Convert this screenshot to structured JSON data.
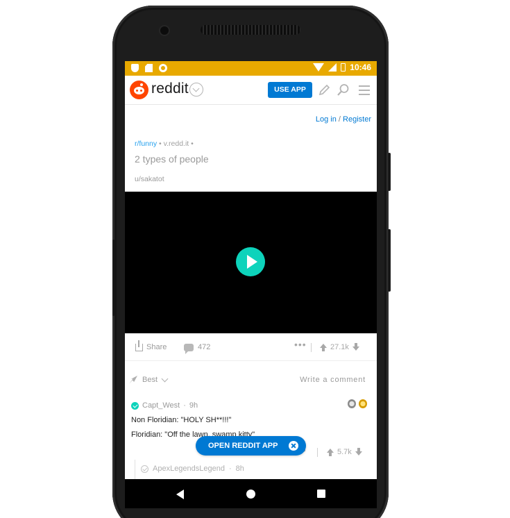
{
  "status_bar": {
    "time": "10:46",
    "background_color": "#e8a900",
    "icons": [
      "shield-icon",
      "sd-card-icon",
      "sync-icon",
      "wifi-icon",
      "cellular-icon",
      "battery-icon"
    ]
  },
  "header": {
    "wordmark": "reddit",
    "use_app_label": "USE APP",
    "brand_color": "#ff4500",
    "accent_color": "#0079d3",
    "icons": [
      "reddit-logo",
      "chevron-down-icon",
      "pencil-icon",
      "search-icon",
      "menu-icon"
    ]
  },
  "auth": {
    "login": "Log in",
    "separator": "/",
    "register": "Register"
  },
  "post": {
    "subreddit": "r/funny",
    "domain": "v.redd.it",
    "title": "2 types of people",
    "author": "u/sakatot"
  },
  "actions": {
    "share_label": "Share",
    "comment_count": "472",
    "score": "27.1k"
  },
  "sort": {
    "label": "Best",
    "write_comment": "Write a comment"
  },
  "comment": {
    "author": "Capt_West",
    "age": "9h",
    "line1": "Non Floridian: \"HOLY SH**!!!\"",
    "line2": "Floridian: \"Off the lawn, swamp kitty\"",
    "score": "5.7k",
    "awards": [
      "silver-award-icon",
      "gold-award-icon"
    ]
  },
  "floating_banner": {
    "label": "OPEN REDDIT APP"
  },
  "reply": {
    "author": "ApexLegendsLegend",
    "age": "8h"
  },
  "nav_bar": {
    "icons": [
      "back-icon",
      "home-icon",
      "recents-icon"
    ]
  }
}
